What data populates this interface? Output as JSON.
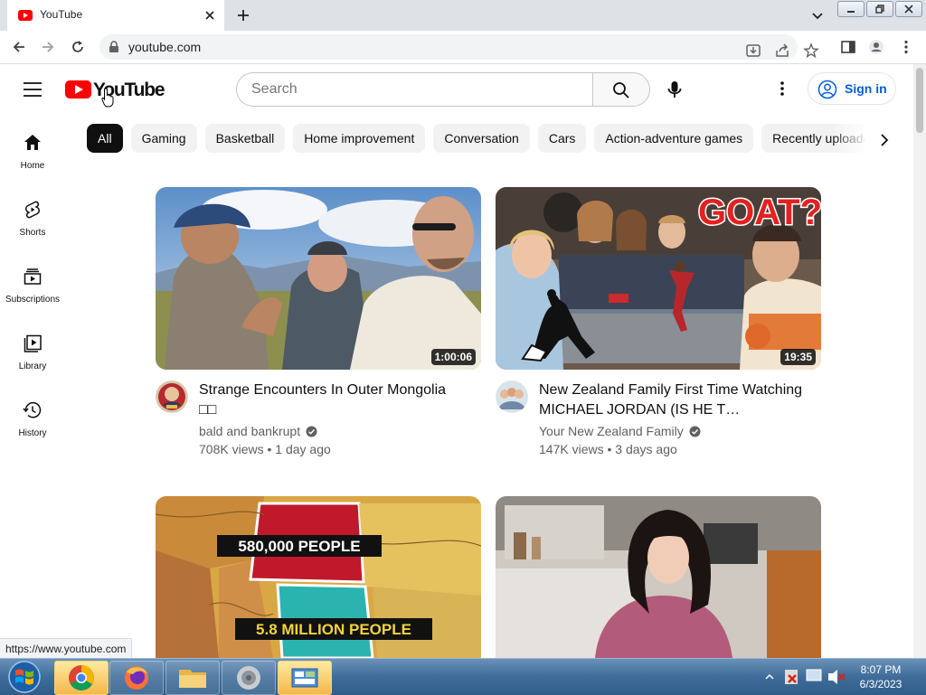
{
  "browser": {
    "tab_title": "YouTube",
    "url": "youtube.com",
    "status_url": "https://www.youtube.com"
  },
  "header": {
    "logo_text": "YouTube",
    "search_placeholder": "Search",
    "signin_label": "Sign in"
  },
  "chips": [
    "All",
    "Gaming",
    "Basketball",
    "Home improvement",
    "Conversation",
    "Cars",
    "Action-adventure games",
    "Recently uploaded"
  ],
  "sidebar": [
    {
      "label": "Home",
      "icon": "home-icon"
    },
    {
      "label": "Shorts",
      "icon": "shorts-icon"
    },
    {
      "label": "Subscriptions",
      "icon": "subscriptions-icon"
    },
    {
      "label": "Library",
      "icon": "library-icon"
    },
    {
      "label": "History",
      "icon": "history-icon"
    }
  ],
  "videos": [
    {
      "title": "Strange Encounters In Outer Mongolia",
      "title_line2": "□□",
      "channel": "bald and bankrupt",
      "views": "708K views",
      "age": "1 day ago",
      "meta": "708K views • 1 day ago",
      "duration": "1:00:06"
    },
    {
      "title": "New Zealand Family First Time Watching MICHAEL JORDAN (IS HE T…",
      "title_line2": "",
      "channel": "Your New Zealand Family",
      "views": "147K views",
      "age": "3 days ago",
      "meta": "147K views • 3 days ago",
      "duration": "19:35",
      "thumb_text": "GOAT?"
    },
    {
      "thumb_text_1": "580,000 PEOPLE",
      "thumb_text_2": "5.8 MILLION PEOPLE"
    },
    {}
  ],
  "taskbar": {
    "time": "8:07 PM",
    "date": "6/3/2023"
  },
  "colors": {
    "brand_red": "#ff0000",
    "link_blue": "#065fd4",
    "chip_bg": "#f2f2f2"
  }
}
